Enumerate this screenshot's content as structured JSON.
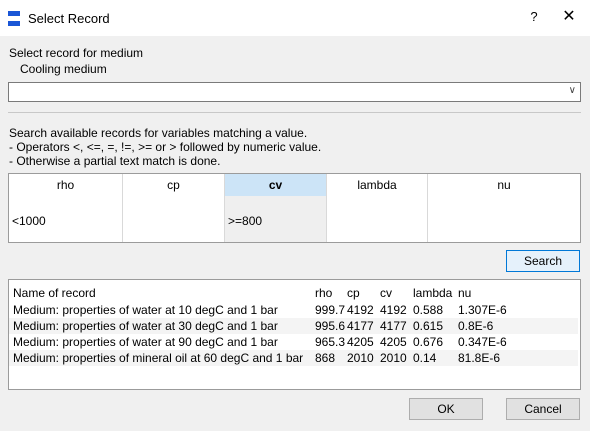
{
  "window": {
    "title": "Select Record",
    "help_label": "?",
    "close_label": "✕"
  },
  "select": {
    "label": "Select record for medium",
    "sublabel": "Cooling medium",
    "value": ""
  },
  "instructions": [
    "Search available records for variables matching a value.",
    "- Operators <, <=, =, !=, >= or > followed by numeric value.",
    "- Otherwise a partial text match is done."
  ],
  "filters": {
    "columns": [
      {
        "name": "rho",
        "value": "<1000"
      },
      {
        "name": "cp",
        "value": ""
      },
      {
        "name": "cv",
        "value": ">=800"
      },
      {
        "name": "lambda",
        "value": ""
      },
      {
        "name": "nu",
        "value": ""
      }
    ],
    "selected_column": "cv"
  },
  "search_label": "Search",
  "results": {
    "headers": [
      "Name of record",
      "rho",
      "cp",
      "cv",
      "lambda",
      "nu"
    ],
    "rows": [
      [
        "Medium: properties of water at 10 degC and 1 bar",
        "999.7",
        "4192",
        "4192",
        "0.588",
        "1.307E-6"
      ],
      [
        "Medium: properties of water at 30 degC and 1 bar",
        "995.6",
        "4177",
        "4177",
        "0.615",
        "0.8E-6"
      ],
      [
        "Medium: properties of water at 90 degC and 1 bar",
        "965.3",
        "4205",
        "4205",
        "0.676",
        "0.347E-6"
      ],
      [
        "Medium: properties of mineral oil at 60 degC and 1 bar",
        "868",
        "2010",
        "2010",
        "0.14",
        "81.8E-6"
      ]
    ]
  },
  "buttons": {
    "ok": "OK",
    "cancel": "Cancel"
  },
  "colors": {
    "accent": "#0078d7",
    "selected_header": "#cce4f7",
    "app_icon": "#1a56d6"
  }
}
